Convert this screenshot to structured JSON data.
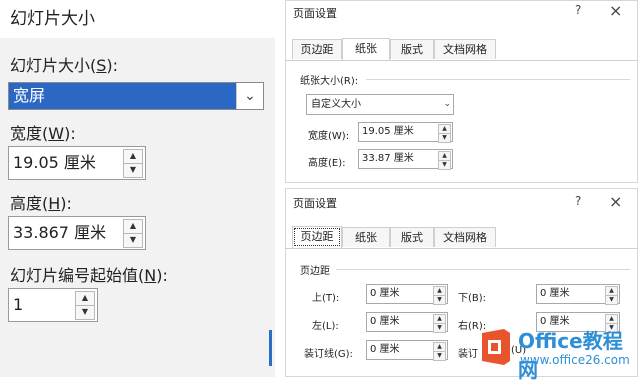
{
  "left_panel": {
    "title": "幻灯片大小",
    "slide_size_label": "幻灯片大小(",
    "slide_size_key": "S",
    "slide_size_suffix": "):",
    "slide_size_value": "宽屏",
    "width_label": "宽度(",
    "width_key": "W",
    "width_suffix": "):",
    "width_value": "19.05 厘米",
    "height_label": "高度(",
    "height_key": "H",
    "height_suffix": "):",
    "height_value": "33.867 厘米",
    "start_label": "幻灯片编号起始值(",
    "start_key": "N",
    "start_suffix": "):",
    "start_value": "1"
  },
  "dialog_top": {
    "title": "页面设置",
    "help": "?",
    "close": "×",
    "tabs": [
      "页边距",
      "纸张",
      "版式",
      "文档网格"
    ],
    "section": "纸张大小(R):",
    "paper_size_value": "自定义大小",
    "width_label": "宽度(W):",
    "width_value": "19.05 厘米",
    "height_label": "高度(E):",
    "height_value": "33.87 厘米"
  },
  "dialog_bottom": {
    "title": "页面设置",
    "help": "?",
    "close": "×",
    "tabs": [
      "页边距",
      "纸张",
      "版式",
      "文档网格"
    ],
    "section": "页边距",
    "top_label": "上(T):",
    "top_value": "0 厘米",
    "bottom_label": "下(B):",
    "bottom_value": "0 厘米",
    "left_label": "左(L):",
    "left_value": "0 厘米",
    "right_label": "右(R):",
    "right_value": "0 厘米",
    "gutter_label": "装订线(G):",
    "gutter_value": "0 厘米",
    "gutter_pos_label": "装订",
    "gutter_pos_value": "(U)"
  },
  "watermark": {
    "brand": "Office教程网",
    "url": "www.office26.com"
  },
  "colors": {
    "selection_blue": "#2b68c4",
    "brand_blue": "#2e8fd6",
    "logo_orange": "#e8542b"
  }
}
